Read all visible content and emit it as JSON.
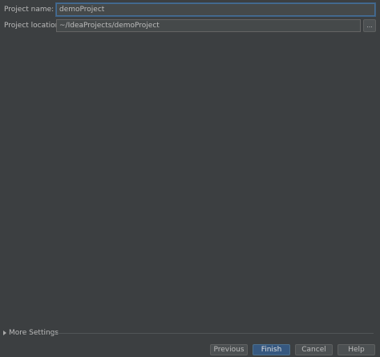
{
  "form": {
    "project_name_label": "Project name:",
    "project_name_value": "demoProject",
    "project_location_label": "Project location:",
    "project_location_value": "~/IdeaProjects/demoProject",
    "browse_label": "..."
  },
  "more_settings": {
    "label": "More Settings",
    "expanded": false
  },
  "buttons": {
    "previous": "Previous",
    "finish": "Finish",
    "cancel": "Cancel",
    "help": "Help"
  },
  "colors": {
    "background": "#3c3f41",
    "field_background": "#45494a",
    "focus_border": "#466d94",
    "default_button": "#365880",
    "text": "#bbbbbb"
  }
}
